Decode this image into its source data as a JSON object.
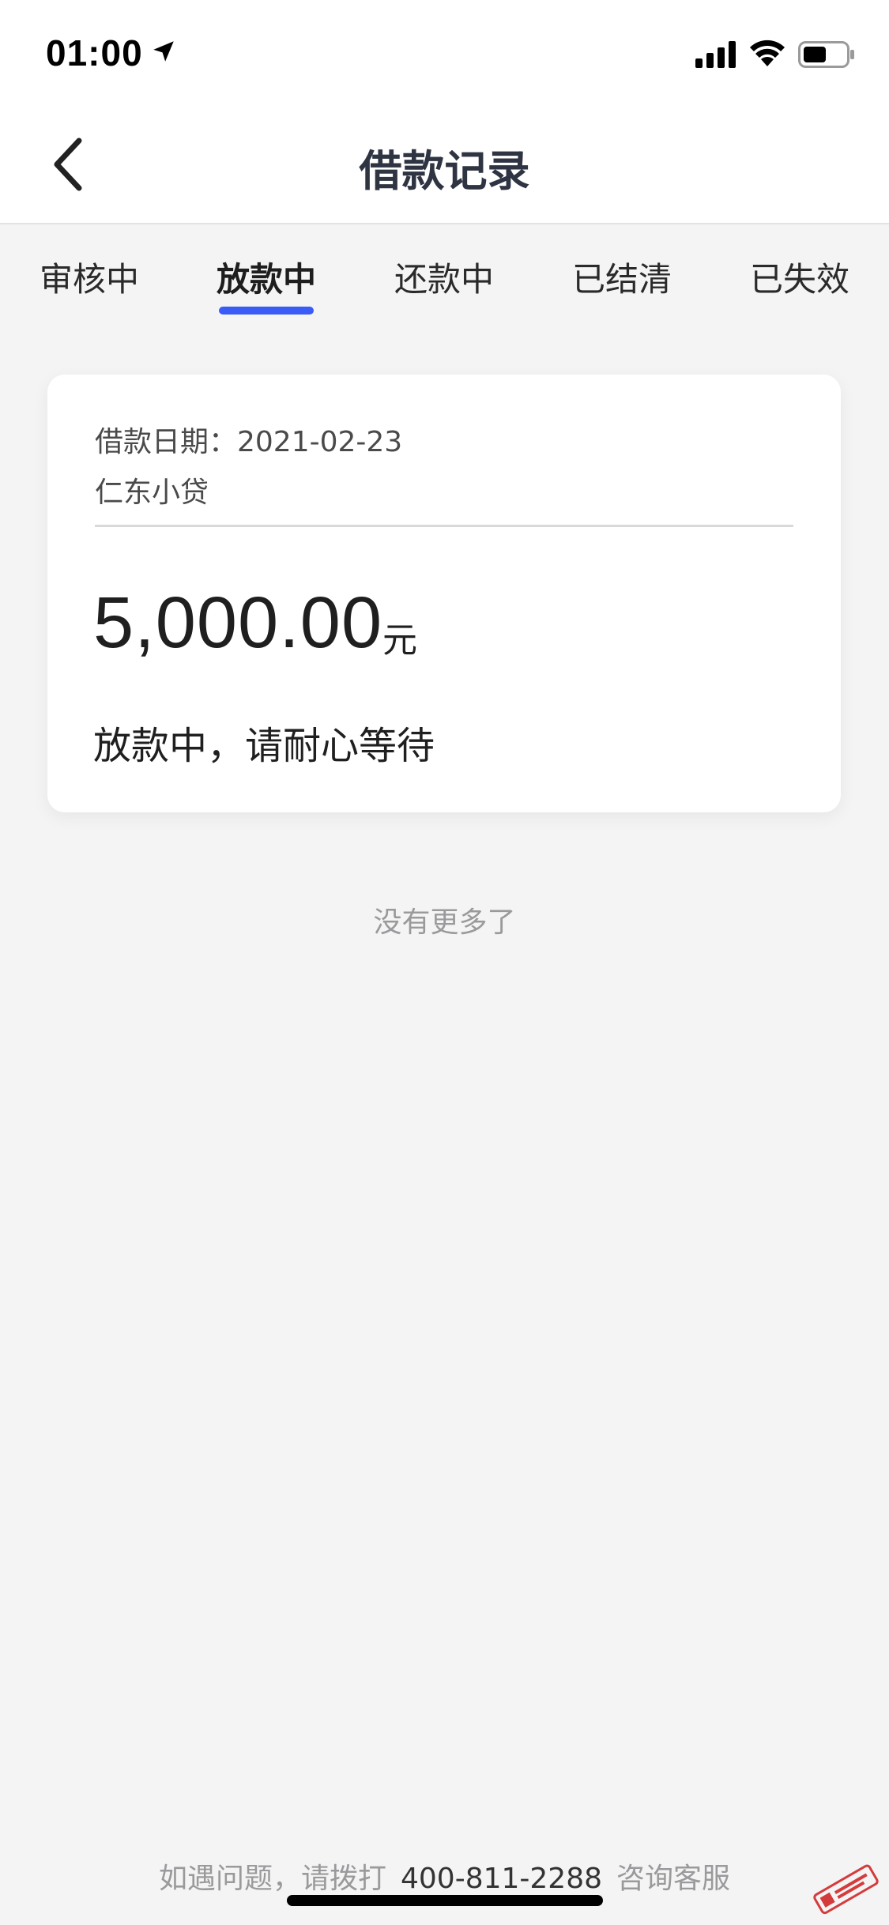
{
  "status_bar": {
    "time": "01:00"
  },
  "nav": {
    "title": "借款记录"
  },
  "tabs": [
    {
      "label": "审核中",
      "active": false
    },
    {
      "label": "放款中",
      "active": true
    },
    {
      "label": "还款中",
      "active": false
    },
    {
      "label": "已结清",
      "active": false
    },
    {
      "label": "已失效",
      "active": false
    }
  ],
  "loan": {
    "date_text": "借款日期：2021-02-23",
    "lender": "仁东小贷",
    "amount": "5,000.00",
    "currency": "元",
    "status_text": "放款中，请耐心等待"
  },
  "list_end_text": "没有更多了",
  "footer": {
    "prefix": "如遇问题，请拨打",
    "phone": "400-811-2288",
    "suffix": "咨询客服"
  },
  "colors": {
    "accent": "#3b5bf6",
    "background": "#f4f4f5"
  }
}
